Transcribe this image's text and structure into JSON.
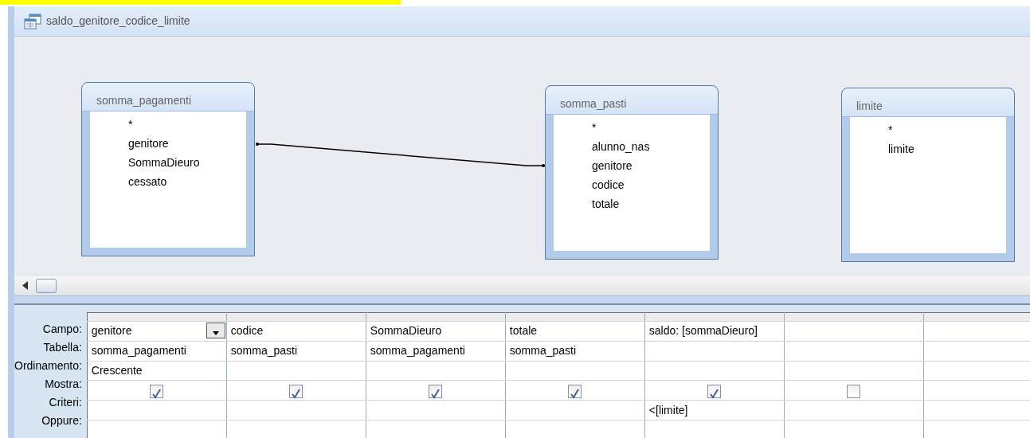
{
  "window": {
    "title": "saldo_genitore_codice_limite"
  },
  "tables": [
    {
      "name": "somma_pagamenti",
      "fields": [
        "*",
        "genitore",
        "SommaDieuro",
        "cessato"
      ]
    },
    {
      "name": "somma_pasti",
      "fields": [
        "*",
        "alunno_nas",
        "genitore",
        "codice",
        "totale"
      ]
    },
    {
      "name": "limite",
      "fields": [
        "*",
        "limite"
      ]
    }
  ],
  "grid": {
    "row_labels": [
      "Campo:",
      "Tabella:",
      "Ordinamento:",
      "Mostra:",
      "Criteri:",
      "Oppure:"
    ],
    "columns": [
      {
        "campo": "genitore",
        "tabella": "somma_pagamenti",
        "ordinamento": "Crescente",
        "mostra": true,
        "selected": true
      },
      {
        "campo": "codice",
        "tabella": "somma_pasti",
        "mostra": true,
        "selected": false
      },
      {
        "campo": "SommaDieuro",
        "tabella": "somma_pagamenti",
        "mostra": true,
        "selected": false
      },
      {
        "campo": "totale",
        "tabella": "somma_pasti",
        "mostra": true,
        "selected": false
      },
      {
        "campo": "saldo: [sommaDieuro]",
        "mostra": true,
        "criteri": "<[limite]",
        "selected": false
      },
      {
        "mostra": false,
        "selected": false
      }
    ]
  }
}
